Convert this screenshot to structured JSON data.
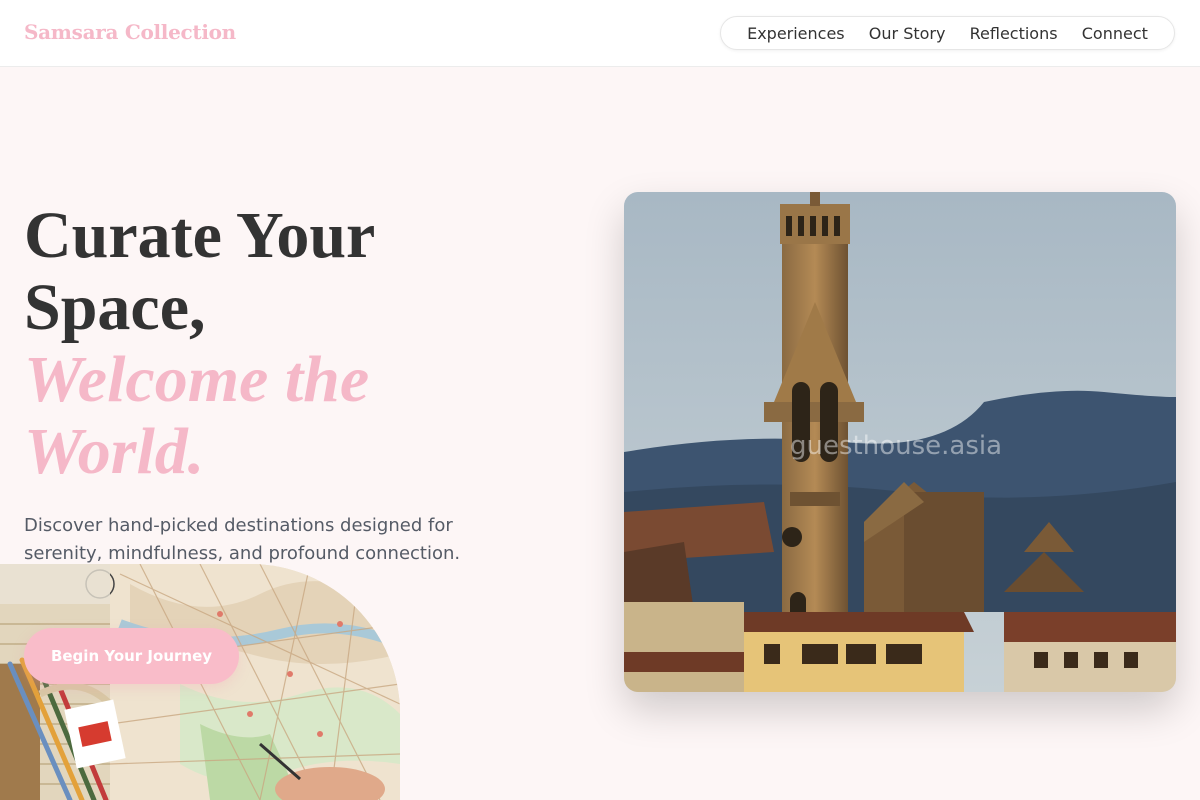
{
  "brand": {
    "name": "Samsara Collection"
  },
  "nav": {
    "items": [
      {
        "label": "Experiences"
      },
      {
        "label": "Our Story"
      },
      {
        "label": "Reflections"
      },
      {
        "label": "Connect"
      }
    ]
  },
  "hero": {
    "headline_line1": "Curate Your",
    "headline_line2": "Space,",
    "accent_line1": "Welcome the",
    "accent_line2": "World.",
    "subcopy": "Discover hand-picked destinations designed for serenity, mindfulness, and profound connection.",
    "cta_label": "Begin Your Journey"
  },
  "photo": {
    "watermark": "guesthouse.asia"
  },
  "colors": {
    "accent": "#f5b8c8",
    "cta": "#f9bcc9",
    "background": "#fdf6f6",
    "text": "#333333",
    "subtext": "#555b66"
  },
  "icons": {
    "map": "map-illustration",
    "photo": "cathedral-photo"
  }
}
